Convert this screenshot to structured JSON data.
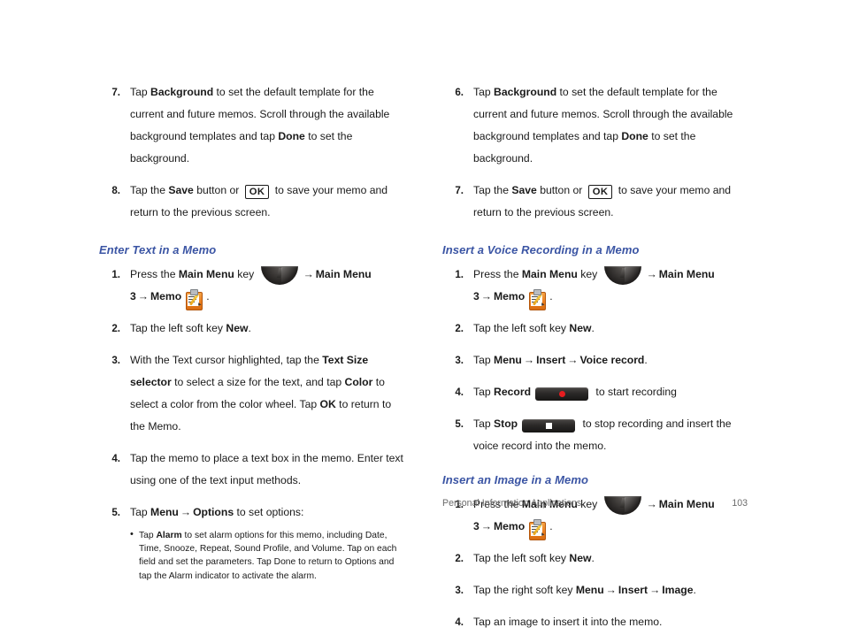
{
  "document": {
    "footer": {
      "chapter": "Personal Information Applications",
      "page_number": "103"
    }
  },
  "icons": {
    "main_menu_key": "main-menu-dome-key-icon",
    "memo": "memo-clipboard-icon",
    "ok_key": "OK",
    "record_button": "record-button-icon",
    "stop_button": "stop-button-icon"
  },
  "colors": {
    "heading_blue": "#3b55a4",
    "body_text": "#1a1a1a",
    "memo_orange": "#ec7f1e",
    "record_red": "#e81d20",
    "footer_gray": "#6b6b6b"
  },
  "left_column": {
    "continued_steps": [
      {
        "number": "7.",
        "parts": [
          {
            "t": "Tap ",
            "s": "n"
          },
          {
            "t": "Background",
            "s": "b"
          },
          {
            "t": " to set the default template for the current and future memos.  Scroll through the available background templates and tap ",
            "s": "n"
          },
          {
            "t": "Done",
            "s": "b"
          },
          {
            "t": " to set the background.",
            "s": "n"
          }
        ]
      },
      {
        "number": "8.",
        "parts": [
          {
            "t": "Tap the ",
            "s": "n"
          },
          {
            "t": "Save",
            "s": "b"
          },
          {
            "t": " button or ",
            "s": "n"
          },
          {
            "t": "",
            "s": "ok"
          },
          {
            "t": " to save your memo and return to the previous screen.",
            "s": "n"
          }
        ]
      }
    ],
    "sections": [
      {
        "heading": "Enter Text in a Memo",
        "steps": [
          {
            "number": "1.",
            "parts": [
              {
                "t": "Press the ",
                "s": "n"
              },
              {
                "t": "Main Menu",
                "s": "b"
              },
              {
                "t": " key ",
                "s": "n"
              },
              {
                "t": "",
                "s": "mainmenu"
              },
              {
                "t": "",
                "s": "arrow"
              },
              {
                "t": "Main Menu 3",
                "s": "b"
              },
              {
                "t": "",
                "s": "arrow"
              },
              {
                "t": "Memo",
                "s": "b"
              },
              {
                "t": "",
                "s": "memo"
              },
              {
                "t": ".",
                "s": "n"
              }
            ]
          },
          {
            "number": "2.",
            "parts": [
              {
                "t": "Tap the left soft key ",
                "s": "n"
              },
              {
                "t": "New",
                "s": "b"
              },
              {
                "t": ".",
                "s": "n"
              }
            ]
          },
          {
            "number": "3.",
            "parts": [
              {
                "t": "With the Text cursor highlighted, tap the ",
                "s": "n"
              },
              {
                "t": "Text Size selector",
                "s": "b"
              },
              {
                "t": " to select a size for the text, and tap ",
                "s": "n"
              },
              {
                "t": "Color",
                "s": "b"
              },
              {
                "t": " to select a color from the color wheel. Tap ",
                "s": "n"
              },
              {
                "t": "OK",
                "s": "b"
              },
              {
                "t": " to return to the Memo.",
                "s": "n"
              }
            ]
          },
          {
            "number": "4.",
            "parts": [
              {
                "t": "Tap the memo to place a text box in the memo.  Enter text using one of the text input methods.",
                "s": "n"
              }
            ]
          },
          {
            "number": "5.",
            "parts": [
              {
                "t": "Tap ",
                "s": "n"
              },
              {
                "t": "Menu",
                "s": "b"
              },
              {
                "t": "",
                "s": "arrow"
              },
              {
                "t": "Options",
                "s": "b"
              },
              {
                "t": " to set options:",
                "s": "n"
              }
            ],
            "bullets": [
              {
                "parts": [
                  {
                    "t": "Tap ",
                    "s": "n"
                  },
                  {
                    "t": "Alarm",
                    "s": "b"
                  },
                  {
                    "t": " to set alarm options for this memo, including Date, Time, Snooze, Repeat, Sound Profile, and Volume.  Tap on each field and set the parameters.  Tap Done to return to Options and tap the Alarm indicator to activate the alarm.",
                    "s": "n"
                  }
                ]
              }
            ]
          }
        ]
      }
    ]
  },
  "right_column": {
    "continued_steps": [
      {
        "number": "6.",
        "parts": [
          {
            "t": "Tap ",
            "s": "n"
          },
          {
            "t": "Background",
            "s": "b"
          },
          {
            "t": " to set the default template for the current and future memos.  Scroll through the available background templates and tap ",
            "s": "n"
          },
          {
            "t": "Done",
            "s": "b"
          },
          {
            "t": " to set the background.",
            "s": "n"
          }
        ]
      },
      {
        "number": "7.",
        "parts": [
          {
            "t": "Tap the ",
            "s": "n"
          },
          {
            "t": "Save",
            "s": "b"
          },
          {
            "t": " button or ",
            "s": "n"
          },
          {
            "t": "",
            "s": "ok"
          },
          {
            "t": " to save your memo and return to the previous screen.",
            "s": "n"
          }
        ]
      }
    ],
    "sections": [
      {
        "heading": "Insert a Voice Recording in a Memo",
        "steps": [
          {
            "number": "1.",
            "parts": [
              {
                "t": "Press the ",
                "s": "n"
              },
              {
                "t": "Main Menu",
                "s": "b"
              },
              {
                "t": " key ",
                "s": "n"
              },
              {
                "t": "",
                "s": "mainmenu"
              },
              {
                "t": "",
                "s": "arrow"
              },
              {
                "t": "Main Menu 3",
                "s": "b"
              },
              {
                "t": "",
                "s": "arrow"
              },
              {
                "t": "Memo",
                "s": "b"
              },
              {
                "t": "",
                "s": "memo"
              },
              {
                "t": ".",
                "s": "n"
              }
            ]
          },
          {
            "number": "2.",
            "parts": [
              {
                "t": "Tap the left soft key ",
                "s": "n"
              },
              {
                "t": "New",
                "s": "b"
              },
              {
                "t": ".",
                "s": "n"
              }
            ]
          },
          {
            "number": "3.",
            "parts": [
              {
                "t": "Tap ",
                "s": "n"
              },
              {
                "t": "Menu",
                "s": "b"
              },
              {
                "t": "",
                "s": "arrow"
              },
              {
                "t": "Insert",
                "s": "b"
              },
              {
                "t": "",
                "s": "arrow"
              },
              {
                "t": "Voice record",
                "s": "b"
              },
              {
                "t": ".",
                "s": "n"
              }
            ]
          },
          {
            "number": "4.",
            "parts": [
              {
                "t": "Tap ",
                "s": "n"
              },
              {
                "t": "Record",
                "s": "b"
              },
              {
                "t": "",
                "s": "record"
              },
              {
                "t": " to start recording",
                "s": "n"
              }
            ]
          },
          {
            "number": "5.",
            "parts": [
              {
                "t": "Tap ",
                "s": "n"
              },
              {
                "t": "Stop",
                "s": "b"
              },
              {
                "t": "",
                "s": "stop"
              },
              {
                "t": " to stop recording and insert the voice record into the memo.",
                "s": "n"
              }
            ]
          }
        ]
      },
      {
        "heading": "Insert an Image in a Memo",
        "steps": [
          {
            "number": "1.",
            "parts": [
              {
                "t": "Press the ",
                "s": "n"
              },
              {
                "t": "Main Menu",
                "s": "b"
              },
              {
                "t": " key ",
                "s": "n"
              },
              {
                "t": "",
                "s": "mainmenu"
              },
              {
                "t": "",
                "s": "arrow"
              },
              {
                "t": "Main Menu 3",
                "s": "b"
              },
              {
                "t": "",
                "s": "arrow"
              },
              {
                "t": "Memo",
                "s": "b"
              },
              {
                "t": "",
                "s": "memo"
              },
              {
                "t": ".",
                "s": "n"
              }
            ]
          },
          {
            "number": "2.",
            "parts": [
              {
                "t": "Tap the left soft key ",
                "s": "n"
              },
              {
                "t": "New",
                "s": "b"
              },
              {
                "t": ".",
                "s": "n"
              }
            ]
          },
          {
            "number": "3.",
            "parts": [
              {
                "t": "Tap the right soft key ",
                "s": "n"
              },
              {
                "t": "Menu",
                "s": "b"
              },
              {
                "t": "",
                "s": "arrow"
              },
              {
                "t": "Insert",
                "s": "b"
              },
              {
                "t": "",
                "s": "arrow"
              },
              {
                "t": "Image",
                "s": "b"
              },
              {
                "t": ".",
                "s": "n"
              }
            ]
          },
          {
            "number": "4.",
            "parts": [
              {
                "t": "Tap an image to insert it into the memo.",
                "s": "n"
              }
            ]
          }
        ]
      }
    ]
  },
  "glyphs": {
    "arrow": "→",
    "bullet": "•"
  }
}
